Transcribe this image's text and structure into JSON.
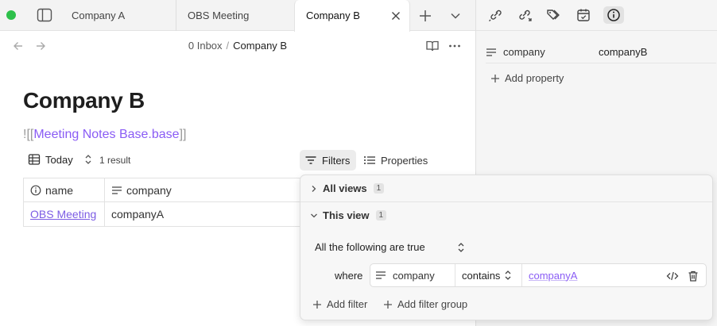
{
  "tabs": [
    {
      "label": "Company A"
    },
    {
      "label": "OBS Meeting"
    },
    {
      "label": "Company B",
      "active": true
    }
  ],
  "breadcrumb": {
    "parent": "0 Inbox",
    "separator": "/",
    "current": "Company B"
  },
  "note": {
    "title": "Company B",
    "embed_prefix": "![[",
    "embed_link": "Meeting Notes Base.base",
    "embed_suffix": "]]"
  },
  "base": {
    "view_name": "Today",
    "result_count": "1 result",
    "filters_label": "Filters",
    "properties_label": "Properties",
    "columns": [
      "name",
      "company"
    ],
    "rows": [
      {
        "name": "OBS Meeting",
        "company": "companyA"
      }
    ]
  },
  "properties_panel": {
    "key": "company",
    "value": "companyB",
    "add_label": "Add property"
  },
  "filter_popover": {
    "all_views_label": "All views",
    "all_views_count": "1",
    "this_view_label": "This view",
    "this_view_count": "1",
    "conjunction": "All the following are true",
    "where_label": "where",
    "rule": {
      "property": "company",
      "operator": "contains",
      "value": "companyA"
    },
    "add_filter": "Add filter",
    "add_filter_group": "Add filter group"
  },
  "colors": {
    "accent": "#8a5cf5",
    "link": "#7c5ce4",
    "status_dot": "#2dc04a"
  }
}
